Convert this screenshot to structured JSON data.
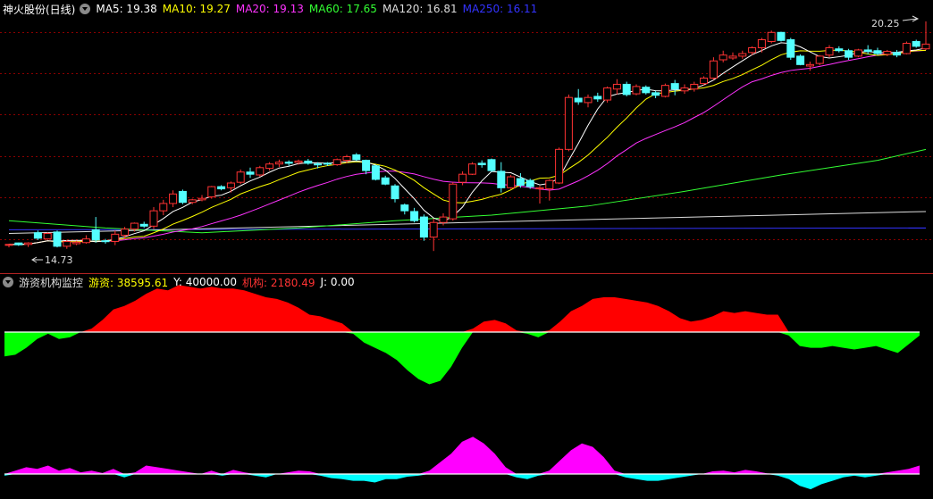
{
  "top_title": "神火股份(日线)",
  "ma_labels": [
    {
      "text": "MA5: 19.38",
      "color": "#ffffff"
    },
    {
      "text": "MA10: 19.27",
      "color": "#ffff00"
    },
    {
      "text": "MA20: 19.13",
      "color": "#ff33ff"
    },
    {
      "text": "MA60: 17.65",
      "color": "#33ff33"
    },
    {
      "text": "MA120: 16.81",
      "color": "#dddddd"
    },
    {
      "text": "MA250: 16.11",
      "color": "#3333ff"
    }
  ],
  "price_max_label": "20.25",
  "price_min_label": "14.73",
  "indicator_title": "游资机构监控",
  "indicator_labels": [
    {
      "name": "游资: ",
      "value": "38595.61",
      "color": "#ffff00"
    },
    {
      "name": "Y: ",
      "value": "40000.00",
      "color": "#ffffff"
    },
    {
      "name": "机构: ",
      "value": "2180.49",
      "color": "#ff3333"
    },
    {
      "name": "J: ",
      "value": "0.00",
      "color": "#ffffff"
    }
  ],
  "colors": {
    "up": "#ff3333",
    "down": "#54ffff",
    "grid": "#8b0000",
    "ma5": "#ffffff",
    "ma10": "#ffff00",
    "ma20": "#ff33ff",
    "ma60": "#33ff33",
    "ma120": "#dddddd",
    "ma250": "#3333ff",
    "fund_pos": "#ff0000",
    "fund_neg": "#00ff00",
    "inst_pos": "#ff00ff",
    "inst_neg": "#00ffff"
  },
  "chart_data": {
    "type": "candlestick",
    "candles": [
      [
        14.78,
        14.82,
        14.72,
        14.8
      ],
      [
        14.84,
        14.85,
        14.76,
        14.79
      ],
      [
        14.8,
        14.86,
        14.73,
        14.84
      ],
      [
        15.12,
        15.18,
        14.92,
        14.97
      ],
      [
        14.95,
        15.13,
        14.92,
        15.1
      ],
      [
        15.14,
        15.18,
        14.72,
        14.75
      ],
      [
        14.75,
        14.92,
        14.68,
        14.88
      ],
      [
        14.82,
        14.9,
        14.78,
        14.86
      ],
      [
        14.85,
        15.05,
        14.82,
        14.95
      ],
      [
        15.2,
        15.55,
        14.85,
        14.92
      ],
      [
        14.9,
        14.95,
        14.82,
        14.88
      ],
      [
        14.88,
        15.18,
        14.78,
        15.08
      ],
      [
        15.05,
        15.28,
        14.95,
        15.22
      ],
      [
        15.22,
        15.4,
        15.15,
        15.38
      ],
      [
        15.35,
        15.42,
        15.25,
        15.3
      ],
      [
        15.3,
        15.82,
        15.22,
        15.72
      ],
      [
        15.72,
        16.02,
        15.6,
        15.92
      ],
      [
        15.92,
        16.28,
        15.82,
        16.18
      ],
      [
        16.25,
        16.3,
        15.9,
        15.95
      ],
      [
        15.95,
        16.05,
        15.9,
        16.02
      ],
      [
        16.02,
        16.15,
        15.98,
        16.06
      ],
      [
        16.1,
        16.4,
        16.05,
        16.38
      ],
      [
        16.38,
        16.42,
        16.28,
        16.32
      ],
      [
        16.35,
        16.52,
        16.22,
        16.48
      ],
      [
        16.5,
        16.85,
        16.45,
        16.78
      ],
      [
        16.78,
        16.9,
        16.62,
        16.72
      ],
      [
        16.7,
        16.95,
        16.65,
        16.9
      ],
      [
        16.88,
        17.05,
        16.82,
        17.0
      ],
      [
        17.0,
        17.12,
        16.92,
        17.05
      ],
      [
        17.05,
        17.1,
        16.95,
        17.02
      ],
      [
        17.04,
        17.12,
        16.98,
        17.08
      ],
      [
        17.08,
        17.14,
        16.98,
        17.02
      ],
      [
        17.0,
        17.05,
        16.88,
        16.98
      ],
      [
        17.02,
        17.05,
        16.95,
        17.0
      ],
      [
        16.98,
        17.15,
        16.95,
        17.12
      ],
      [
        17.1,
        17.25,
        17.02,
        17.2
      ],
      [
        17.25,
        17.3,
        17.08,
        17.12
      ],
      [
        17.1,
        17.12,
        16.72,
        16.82
      ],
      [
        16.95,
        16.98,
        16.55,
        16.58
      ],
      [
        16.62,
        16.68,
        16.42,
        16.45
      ],
      [
        16.4,
        16.45,
        15.95,
        16.05
      ],
      [
        15.88,
        15.92,
        15.62,
        15.72
      ],
      [
        15.7,
        15.8,
        15.4,
        15.45
      ],
      [
        15.55,
        15.62,
        14.9,
        15.0
      ],
      [
        15.0,
        15.5,
        14.62,
        15.4
      ],
      [
        15.4,
        15.65,
        15.32,
        15.55
      ],
      [
        15.5,
        16.5,
        15.45,
        16.45
      ],
      [
        16.5,
        16.8,
        16.42,
        16.72
      ],
      [
        16.72,
        17.05,
        16.7,
        17.0
      ],
      [
        17.02,
        17.1,
        16.9,
        16.98
      ],
      [
        17.12,
        17.15,
        16.78,
        16.82
      ],
      [
        16.8,
        17.05,
        16.22,
        16.35
      ],
      [
        16.35,
        16.7,
        16.32,
        16.65
      ],
      [
        16.6,
        16.75,
        16.35,
        16.42
      ],
      [
        16.55,
        16.6,
        16.32,
        16.38
      ],
      [
        16.32,
        16.4,
        15.92,
        16.35
      ],
      [
        16.32,
        16.58,
        16.0,
        16.55
      ],
      [
        16.48,
        17.45,
        16.45,
        17.4
      ],
      [
        17.4,
        18.9,
        17.35,
        18.82
      ],
      [
        18.8,
        19.05,
        18.62,
        18.7
      ],
      [
        18.68,
        18.9,
        18.55,
        18.82
      ],
      [
        18.85,
        18.95,
        18.7,
        18.78
      ],
      [
        18.75,
        19.12,
        18.68,
        19.08
      ],
      [
        19.05,
        19.32,
        18.9,
        19.18
      ],
      [
        19.18,
        19.25,
        18.85,
        18.9
      ],
      [
        18.92,
        19.18,
        18.88,
        19.12
      ],
      [
        19.1,
        19.15,
        18.9,
        18.95
      ],
      [
        18.95,
        19.0,
        18.8,
        18.88
      ],
      [
        18.85,
        19.2,
        18.82,
        19.15
      ],
      [
        19.2,
        19.3,
        18.88,
        19.05
      ],
      [
        19.0,
        19.18,
        18.92,
        19.08
      ],
      [
        19.05,
        19.25,
        18.98,
        19.18
      ],
      [
        19.2,
        19.4,
        19.15,
        19.35
      ],
      [
        19.35,
        19.92,
        19.3,
        19.82
      ],
      [
        19.85,
        20.1,
        19.78,
        19.98
      ],
      [
        19.9,
        20.05,
        19.85,
        19.95
      ],
      [
        19.95,
        20.1,
        19.88,
        20.02
      ],
      [
        20.05,
        20.22,
        19.98,
        20.18
      ],
      [
        20.18,
        20.45,
        20.05,
        20.4
      ],
      [
        20.35,
        20.65,
        20.3,
        20.6
      ],
      [
        20.6,
        20.62,
        20.35,
        20.38
      ],
      [
        20.4,
        20.45,
        19.85,
        19.92
      ],
      [
        19.95,
        20.0,
        19.7,
        19.72
      ],
      [
        19.68,
        19.8,
        19.55,
        19.72
      ],
      [
        19.75,
        19.98,
        19.7,
        19.95
      ],
      [
        19.98,
        20.25,
        19.92,
        20.18
      ],
      [
        20.15,
        20.22,
        20.05,
        20.1
      ],
      [
        20.1,
        20.15,
        19.85,
        19.92
      ],
      [
        19.95,
        20.15,
        19.92,
        20.12
      ],
      [
        20.12,
        20.25,
        20.0,
        20.08
      ],
      [
        20.1,
        20.18,
        19.98,
        20.02
      ],
      [
        20.0,
        20.12,
        19.95,
        20.08
      ],
      [
        20.05,
        20.12,
        19.92,
        19.98
      ],
      [
        20.02,
        20.35,
        20.0,
        20.3
      ],
      [
        20.35,
        20.4,
        20.18,
        20.22
      ],
      [
        20.15,
        20.9,
        20.12,
        20.28
      ]
    ],
    "ma120": [
      [
        0,
        15.1
      ],
      [
        95,
        15.7
      ]
    ],
    "ma250": [
      [
        0,
        15.2
      ],
      [
        95,
        15.25
      ]
    ],
    "ma60_path": [
      [
        0,
        15.45
      ],
      [
        10,
        15.25
      ],
      [
        20,
        15.12
      ],
      [
        30,
        15.25
      ],
      [
        40,
        15.45
      ],
      [
        50,
        15.6
      ],
      [
        60,
        15.85
      ],
      [
        70,
        16.25
      ],
      [
        80,
        16.7
      ],
      [
        90,
        17.1
      ],
      [
        95,
        17.4
      ]
    ],
    "fund": [
      -70,
      -65,
      -45,
      -20,
      -5,
      -20,
      -15,
      0,
      10,
      35,
      65,
      75,
      90,
      110,
      125,
      120,
      135,
      130,
      125,
      130,
      125,
      125,
      120,
      110,
      100,
      95,
      85,
      70,
      50,
      45,
      35,
      25,
      -5,
      -30,
      -45,
      -60,
      -80,
      -110,
      -135,
      -150,
      -140,
      -100,
      -45,
      10,
      30,
      35,
      25,
      5,
      -5,
      -15,
      5,
      30,
      60,
      75,
      95,
      100,
      100,
      95,
      90,
      85,
      75,
      60,
      40,
      30,
      35,
      45,
      60,
      55,
      60,
      55,
      50,
      50,
      -10,
      -40,
      -45,
      -45,
      -40,
      -45,
      -50,
      -45,
      -40,
      -50,
      -60,
      -35,
      -10
    ],
    "inst": [
      -5,
      10,
      20,
      15,
      25,
      10,
      18,
      5,
      10,
      3,
      15,
      -10,
      5,
      25,
      20,
      15,
      10,
      5,
      0,
      10,
      -5,
      12,
      5,
      -5,
      -10,
      0,
      5,
      10,
      8,
      -5,
      -12,
      -15,
      -20,
      -20,
      -25,
      -15,
      -15,
      -8,
      -5,
      10,
      35,
      60,
      95,
      110,
      90,
      60,
      20,
      -10,
      -15,
      -5,
      10,
      40,
      70,
      90,
      80,
      50,
      10,
      -10,
      -15,
      -20,
      -20,
      -15,
      -10,
      -5,
      0,
      8,
      10,
      5,
      12,
      8,
      2,
      -5,
      -15,
      -35,
      -45,
      -30,
      -20,
      -10,
      -5,
      -10,
      -5,
      5,
      10,
      15,
      25
    ]
  }
}
